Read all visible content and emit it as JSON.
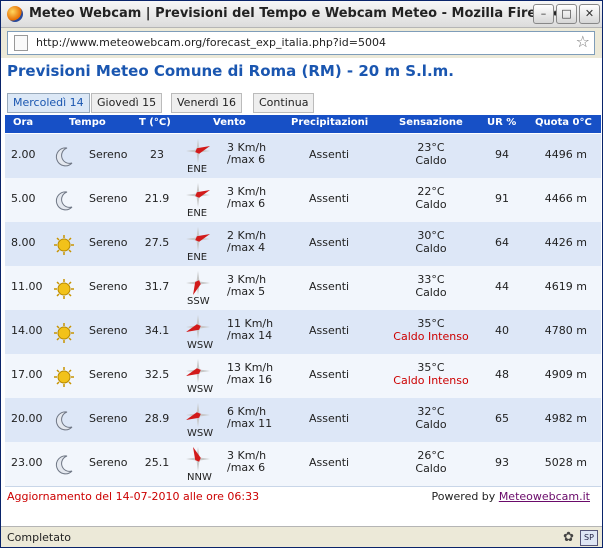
{
  "window": {
    "title": "Meteo Webcam | Previsioni del Tempo e Webcam Meteo - Mozilla Firefox",
    "url": "http://www.meteowebcam.org/forecast_exp_italia.php?id=5004",
    "status": "Completato"
  },
  "page": {
    "heading": "Previsioni Meteo Comune di Roma (RM) - 20 m S.l.m.",
    "tabs": [
      "Mercoledì 14",
      "Giovedì 15",
      "Venerdì 16",
      "Continua"
    ],
    "active_tab": 0
  },
  "table": {
    "headers": [
      "Ora",
      "Tempo",
      "T (°C)",
      "Vento",
      "Precipitazioni",
      "Sensazione",
      "UR %",
      "Quota 0°C"
    ],
    "rows": [
      {
        "ora": "2.00",
        "icon": "moon-icon",
        "tempo": "Sereno",
        "temp": "23",
        "wind_dir": "ENE",
        "wind_speed": "3 Km/h",
        "wind_max": "/max 6",
        "precip": "Assenti",
        "sens_temp": "23°C",
        "sens_desc": "Caldo",
        "sens_hot": false,
        "ur": "94",
        "quota": "4496 m"
      },
      {
        "ora": "5.00",
        "icon": "moon-icon",
        "tempo": "Sereno",
        "temp": "21.9",
        "wind_dir": "ENE",
        "wind_speed": "3 Km/h",
        "wind_max": "/max 6",
        "precip": "Assenti",
        "sens_temp": "22°C",
        "sens_desc": "Caldo",
        "sens_hot": false,
        "ur": "91",
        "quota": "4466 m"
      },
      {
        "ora": "8.00",
        "icon": "sun-icon",
        "tempo": "Sereno",
        "temp": "27.5",
        "wind_dir": "ENE",
        "wind_speed": "2 Km/h",
        "wind_max": "/max 4",
        "precip": "Assenti",
        "sens_temp": "30°C",
        "sens_desc": "Caldo",
        "sens_hot": false,
        "ur": "64",
        "quota": "4426 m"
      },
      {
        "ora": "11.00",
        "icon": "sun-icon",
        "tempo": "Sereno",
        "temp": "31.7",
        "wind_dir": "SSW",
        "wind_speed": "3 Km/h",
        "wind_max": "/max 5",
        "precip": "Assenti",
        "sens_temp": "33°C",
        "sens_desc": "Caldo",
        "sens_hot": false,
        "ur": "44",
        "quota": "4619 m"
      },
      {
        "ora": "14.00",
        "icon": "sun-icon",
        "tempo": "Sereno",
        "temp": "34.1",
        "wind_dir": "WSW",
        "wind_speed": "11 Km/h",
        "wind_max": "/max 14",
        "precip": "Assenti",
        "sens_temp": "35°C",
        "sens_desc": "Caldo Intenso",
        "sens_hot": true,
        "ur": "40",
        "quota": "4780 m"
      },
      {
        "ora": "17.00",
        "icon": "sun-icon",
        "tempo": "Sereno",
        "temp": "32.5",
        "wind_dir": "WSW",
        "wind_speed": "13 Km/h",
        "wind_max": "/max 16",
        "precip": "Assenti",
        "sens_temp": "35°C",
        "sens_desc": "Caldo Intenso",
        "sens_hot": true,
        "ur": "48",
        "quota": "4909 m"
      },
      {
        "ora": "20.00",
        "icon": "moon-icon",
        "tempo": "Sereno",
        "temp": "28.9",
        "wind_dir": "WSW",
        "wind_speed": "6 Km/h",
        "wind_max": "/max 11",
        "precip": "Assenti",
        "sens_temp": "32°C",
        "sens_desc": "Caldo",
        "sens_hot": false,
        "ur": "65",
        "quota": "4982 m"
      },
      {
        "ora": "23.00",
        "icon": "moon-icon",
        "tempo": "Sereno",
        "temp": "25.1",
        "wind_dir": "NNW",
        "wind_speed": "3 Km/h",
        "wind_max": "/max 6",
        "precip": "Assenti",
        "sens_temp": "26°C",
        "sens_desc": "Caldo",
        "sens_hot": false,
        "ur": "93",
        "quota": "5028 m"
      }
    ]
  },
  "footer": {
    "update": "Aggiornamento del 14-07-2010 alle ore 06:33",
    "powered_label": "Powered by",
    "powered_link": "Meteowebcam.it"
  },
  "colors": {
    "header_bg": "#1750c6",
    "heading": "#1a56b0",
    "alert": "#cc0000"
  }
}
